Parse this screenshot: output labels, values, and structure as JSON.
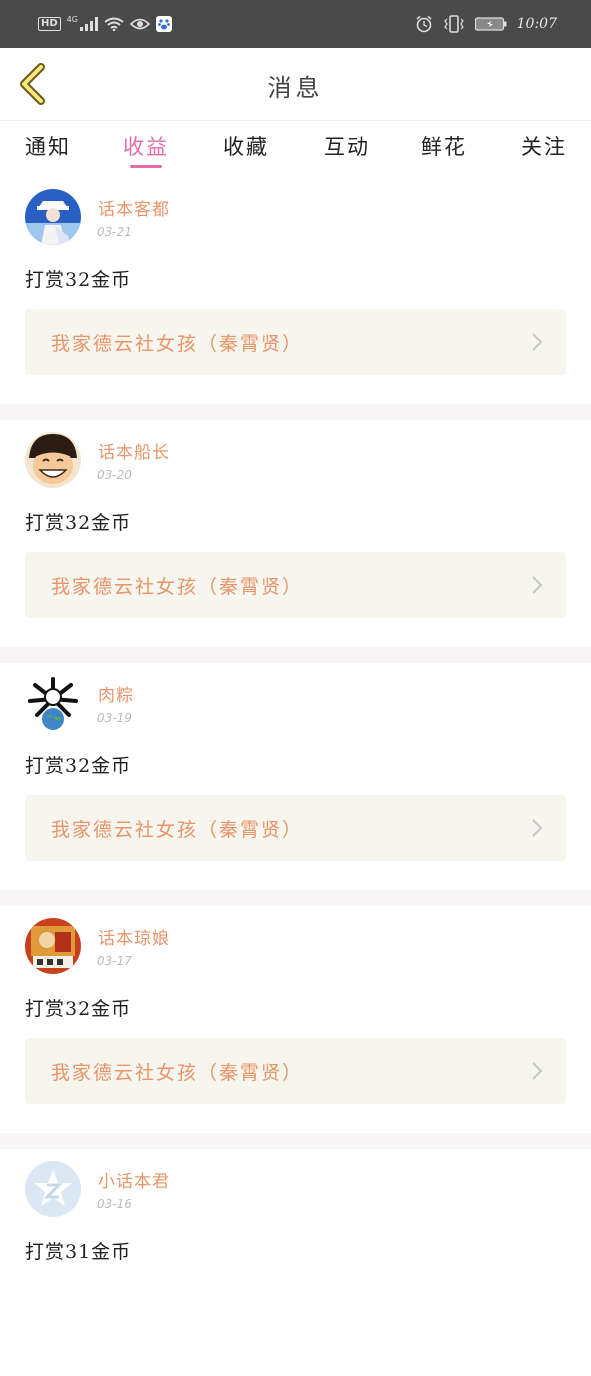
{
  "status_bar": {
    "hd": "HD",
    "network": "4G",
    "time": "10:07"
  },
  "header": {
    "title": "消息"
  },
  "tabs": [
    {
      "label": "通知",
      "active": false
    },
    {
      "label": "收益",
      "active": true
    },
    {
      "label": "收藏",
      "active": false
    },
    {
      "label": "互动",
      "active": false
    },
    {
      "label": "鲜花",
      "active": false
    },
    {
      "label": "关注",
      "active": false
    }
  ],
  "messages": [
    {
      "user": "话本客都",
      "date": "03-21",
      "text": "打赏32金币",
      "book": "我家德云社女孩（秦霄贤）",
      "avatar": "avatar-kid"
    },
    {
      "user": "话本船长",
      "date": "03-20",
      "text": "打赏32金币",
      "book": "我家德云社女孩（秦霄贤）",
      "avatar": "avatar-luffy"
    },
    {
      "user": "肉粽",
      "date": "03-19",
      "text": "打赏32金币",
      "book": "我家德云社女孩（秦霄贤）",
      "avatar": "avatar-cartoon"
    },
    {
      "user": "话本琼娘",
      "date": "03-17",
      "text": "打赏32金币",
      "book": "我家德云社女孩（秦霄贤）",
      "avatar": "avatar-art"
    },
    {
      "user": "小话本君",
      "date": "03-16",
      "text": "打赏31金币",
      "book": "",
      "avatar": "avatar-default"
    }
  ],
  "colors": {
    "accent_pink": "#e46fa6",
    "accent_orange": "#e8956a",
    "card_bg": "#f6f5ee",
    "status_bar_bg": "#4a4a4a"
  }
}
